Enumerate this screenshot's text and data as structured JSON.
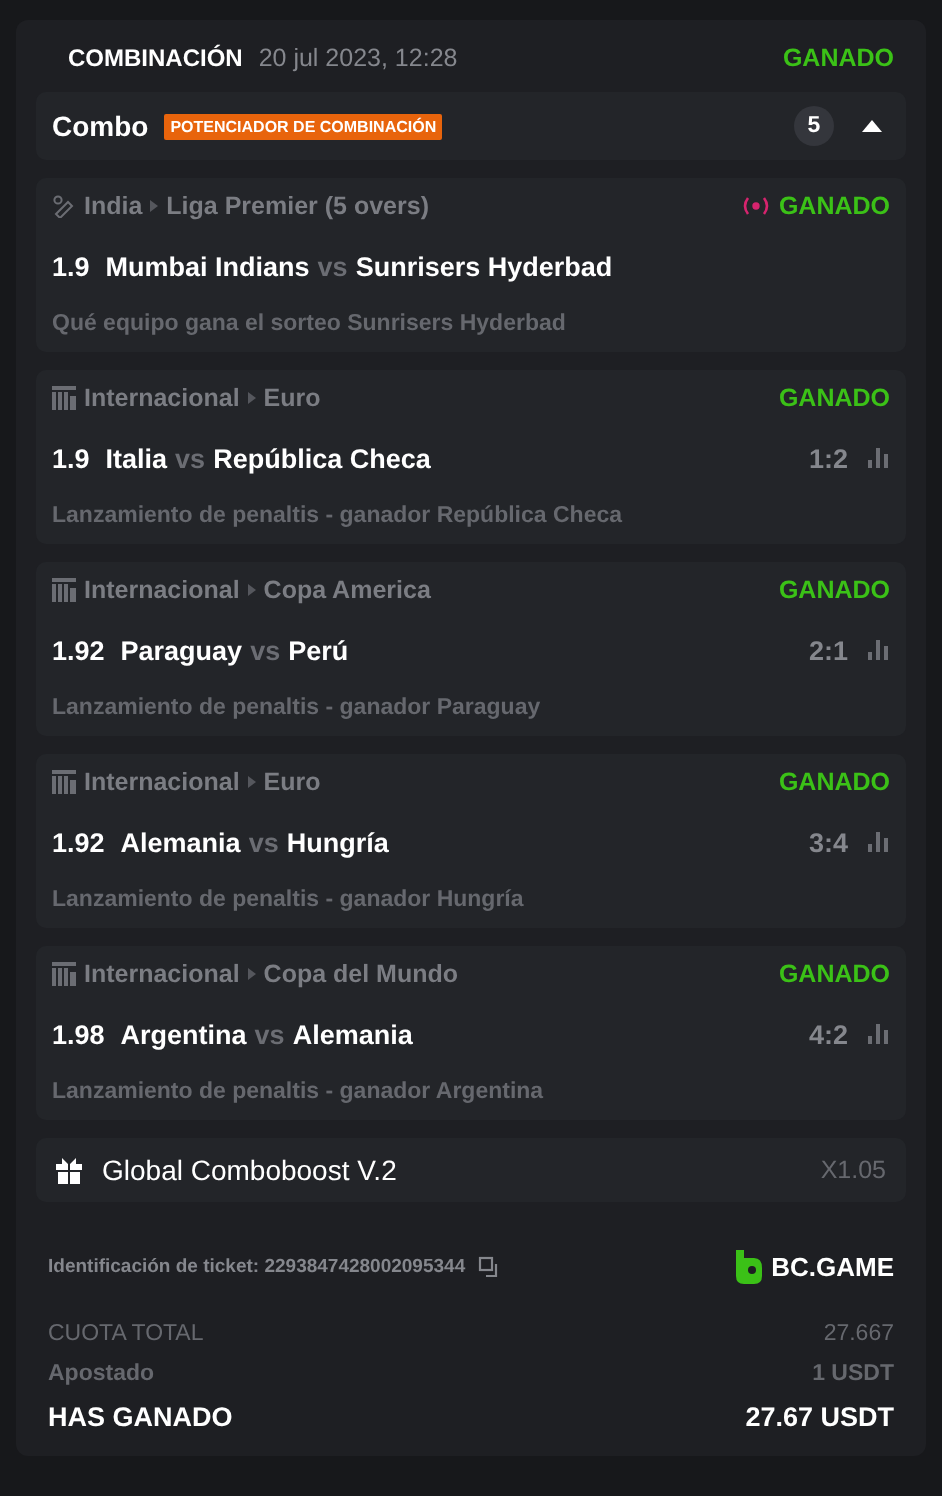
{
  "header": {
    "type": "COMBINACIÓN",
    "date": "20 jul 2023, 12:28",
    "status": "GANADO"
  },
  "combo": {
    "title": "Combo",
    "badge": "POTENCIADOR DE COMBINACIÓN",
    "count": "5",
    "expanded": true
  },
  "legs": [
    {
      "kind": "cricket",
      "category": "India",
      "league": "Liga Premier (5 overs)",
      "live": true,
      "status": "GANADO",
      "odds": "1.9",
      "home": "Mumbai Indians",
      "vs": "vs",
      "away": "Sunrisers Hyderbad",
      "market": "Qué equipo gana el sorteo Sunrisers Hyderbad"
    },
    {
      "kind": "penalty",
      "category": "Internacional",
      "league": "Euro",
      "live": false,
      "status": "GANADO",
      "odds": "1.9",
      "home": "Italia",
      "vs": "vs",
      "away": "República Checa",
      "score": "1:2",
      "market": "Lanzamiento de penaltis - ganador República Checa"
    },
    {
      "kind": "penalty",
      "category": "Internacional",
      "league": "Copa America",
      "live": false,
      "status": "GANADO",
      "odds": "1.92",
      "home": "Paraguay",
      "vs": "vs",
      "away": "Perú",
      "score": "2:1",
      "market": "Lanzamiento de penaltis - ganador Paraguay"
    },
    {
      "kind": "penalty",
      "category": "Internacional",
      "league": "Euro",
      "live": false,
      "status": "GANADO",
      "odds": "1.92",
      "home": "Alemania",
      "vs": "vs",
      "away": "Hungría",
      "score": "3:4",
      "market": "Lanzamiento de penaltis - ganador Hungría"
    },
    {
      "kind": "penalty",
      "category": "Internacional",
      "league": "Copa del Mundo",
      "live": false,
      "status": "GANADO",
      "odds": "1.98",
      "home": "Argentina",
      "vs": "vs",
      "away": "Alemania",
      "score": "4:2",
      "market": "Lanzamiento de penaltis - ganador Argentina"
    }
  ],
  "boost": {
    "name": "Global Comboboost V.2",
    "multiplier": "X1.05"
  },
  "ticket": {
    "label": "Identificación de ticket: 2293847428002095344",
    "brand": "BC.GAME"
  },
  "totals": [
    {
      "kind": "plain",
      "label": "CUOTA TOTAL",
      "value": "27.667"
    },
    {
      "kind": "strong",
      "label": "Apostado",
      "value": "1 USDT"
    },
    {
      "kind": "total",
      "label": "HAS GANADO",
      "value": "27.67 USDT"
    }
  ]
}
